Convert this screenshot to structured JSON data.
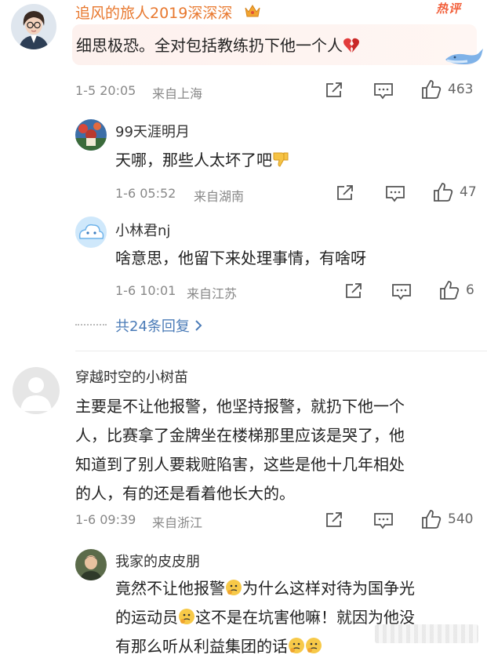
{
  "comments": [
    {
      "username": "追风的旅人2019深深深",
      "badge": "热评",
      "text": "细思极恐。全对包括教练扔下他一个人",
      "time": "1-5 20:05",
      "location": "来自上海",
      "likes": "463",
      "replies": [
        {
          "username": "99天涯明月",
          "text": "天哪，那些人太坏了吧",
          "time": "1-6 05:52",
          "location": "来自湖南",
          "likes": "47"
        },
        {
          "username": "小林君nj",
          "text": "啥意思，他留下来处理事情，有啥呀",
          "time": "1-6 10:01",
          "location": "来自江苏",
          "likes": "6"
        }
      ],
      "more_replies": "共24条回复"
    },
    {
      "username": "穿越时空的小树苗",
      "lines": [
        "主要是不让他报警，他坚持报警，就扔下他一个",
        "人，比赛拿了金牌坐在楼梯那里应该是哭了，他",
        "知道到了别人要栽赃陷害，这些是他十几年相处",
        "的人，有的还是看着他长大的。"
      ],
      "time": "1-6 09:39",
      "location": "来自浙江",
      "likes": "540",
      "replies": [
        {
          "username": "我家的皮皮朋",
          "segments": [
            "竟然不让他报警",
            "为什么这样对待为国争光",
            "的运动员",
            "这不是在坑害他嘛！就因为他没",
            "有那么听从利益集团的话"
          ]
        }
      ]
    }
  ],
  "colors": {
    "username_highlight": "#e8782e",
    "link": "#4a7bb7",
    "badge": "#f25f3a"
  },
  "icons": [
    "share-icon",
    "comment-icon",
    "like-icon",
    "crown-icon",
    "broken-heart-icon",
    "thumbs-down-icon",
    "thinking-face-icon",
    "whale-icon",
    "chevron-right-icon"
  ]
}
